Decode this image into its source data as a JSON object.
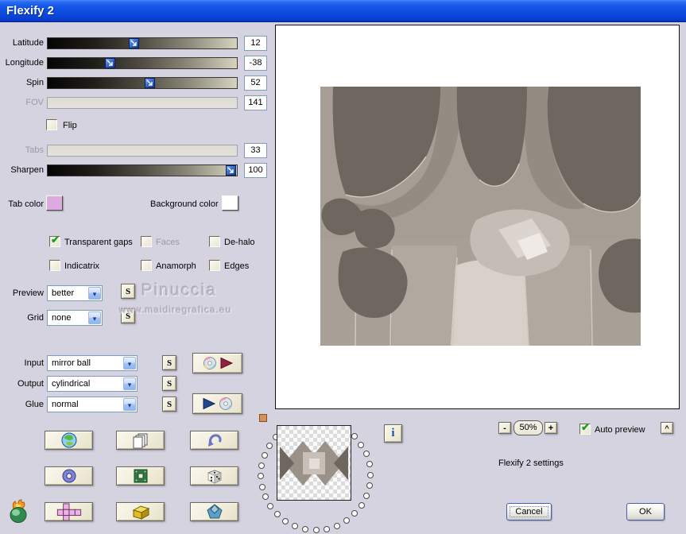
{
  "window": {
    "title": "Flexify 2"
  },
  "colors": {
    "titlebar_blue": "#0d4ae0",
    "dialog_background": "#d5d3e0",
    "tab_color_swatch": "#dcaade",
    "background_color_swatch": "#ffffff",
    "slider_handle_blue": "#3b6ed0",
    "check_green": "#17a017"
  },
  "sliders": [
    {
      "label": "Latitude",
      "value": "12",
      "disabled": false
    },
    {
      "label": "Longitude",
      "value": "-38",
      "disabled": false
    },
    {
      "label": "Spin",
      "value": "52",
      "disabled": false
    },
    {
      "label": "FOV",
      "value": "141",
      "disabled": true
    },
    {
      "label": "Tabs",
      "value": "33",
      "disabled": true
    },
    {
      "label": "Sharpen",
      "value": "100",
      "disabled": false
    }
  ],
  "flip": {
    "label": "Flip",
    "checked": false
  },
  "tab_color": {
    "label": "Tab color"
  },
  "background_color": {
    "label": "Background color"
  },
  "options": {
    "transparent_gaps": {
      "label": "Transparent gaps",
      "checked": true
    },
    "faces": {
      "label": "Faces",
      "checked": false,
      "disabled": true
    },
    "de_halo": {
      "label": "De-halo",
      "checked": false
    },
    "indicatrix": {
      "label": "Indicatrix",
      "checked": false
    },
    "anamorph": {
      "label": "Anamorph",
      "checked": false
    },
    "edges": {
      "label": "Edges",
      "checked": false
    }
  },
  "dropdowns": {
    "preview": {
      "label": "Preview",
      "value": "better"
    },
    "grid": {
      "label": "Grid",
      "value": "none"
    },
    "input": {
      "label": "Input",
      "value": "mirror ball"
    },
    "output": {
      "label": "Output",
      "value": "cylindrical"
    },
    "glue": {
      "label": "Glue",
      "value": "normal"
    }
  },
  "s_button_label": "S",
  "watermark": {
    "line1": "Pinuccia",
    "line2": "www.maidiregrafica.eu"
  },
  "icons": {
    "grid_buttons": [
      "globe-icon",
      "copy-icon",
      "undo-icon",
      "torus-icon",
      "frame-icon",
      "dice-icon",
      "unfolded-cube-icon",
      "box-icon",
      "polyhedron-icon"
    ],
    "disc_buttons": [
      "disc-export-icon",
      "disc-import-icon"
    ],
    "logo": "flaming-pear-logo"
  },
  "preview_controls": {
    "zoom_out": "-",
    "zoom_level": "50%",
    "zoom_in": "+",
    "auto_preview_label": "Auto preview",
    "auto_preview_checked": true,
    "collapse": "^",
    "info": "i"
  },
  "status_text": "Flexify 2 settings",
  "actions": {
    "cancel": "Cancel",
    "ok": "OK"
  }
}
